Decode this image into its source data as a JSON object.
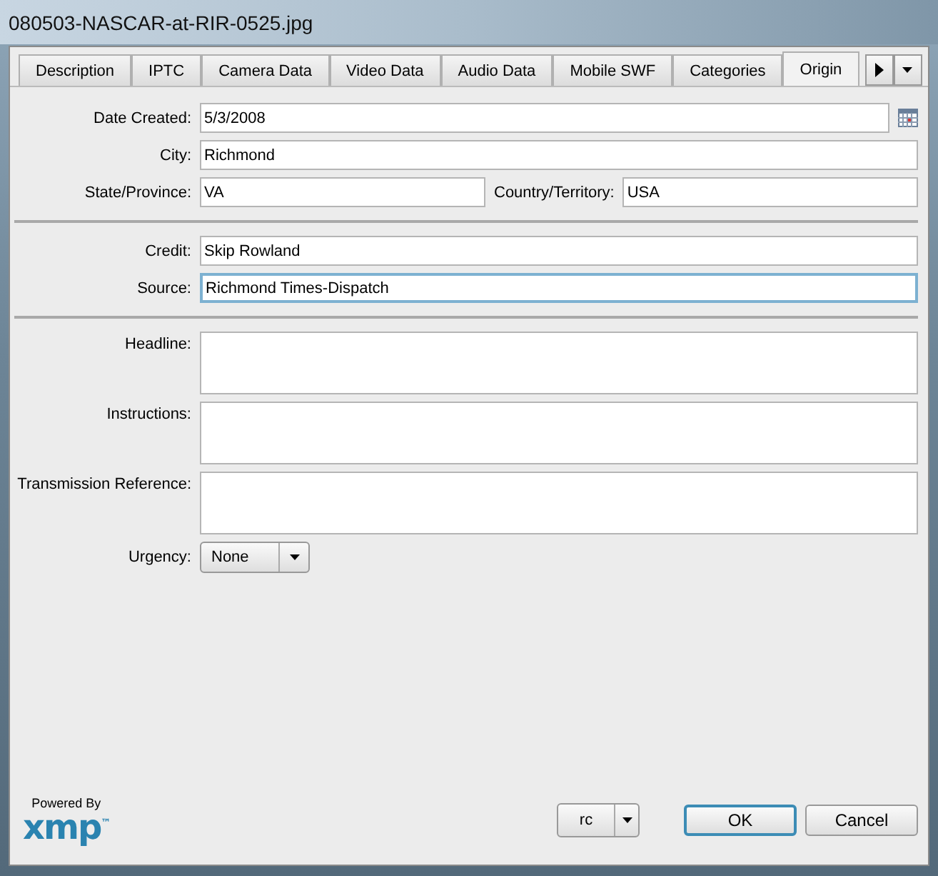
{
  "window": {
    "title": "080503-NASCAR-at-RIR-0525.jpg"
  },
  "tabs": [
    {
      "label": "Description",
      "selected": false
    },
    {
      "label": "IPTC",
      "selected": false
    },
    {
      "label": "Camera Data",
      "selected": false
    },
    {
      "label": "Video Data",
      "selected": false
    },
    {
      "label": "Audio Data",
      "selected": false
    },
    {
      "label": "Mobile SWF",
      "selected": false
    },
    {
      "label": "Categories",
      "selected": false
    },
    {
      "label": "Origin",
      "selected": true
    }
  ],
  "sections": [
    [
      {
        "kind": "date",
        "label": "Date Created:",
        "value": "5/3/2008",
        "focused": false
      },
      {
        "kind": "text",
        "label": "City:",
        "value": "Richmond",
        "focused": false
      },
      {
        "kind": "pair",
        "label": "State/Province:",
        "value": "VA",
        "label2": "Country/Territory:",
        "value2": "USA",
        "focused": false
      }
    ],
    [
      {
        "kind": "text",
        "label": "Credit:",
        "value": "Skip Rowland",
        "focused": false
      },
      {
        "kind": "text",
        "label": "Source:",
        "value": "Richmond Times-Dispatch",
        "focused": true
      }
    ],
    [
      {
        "kind": "area",
        "label": "Headline:",
        "focused": false
      },
      {
        "kind": "area",
        "label": "Instructions:",
        "focused": false
      },
      {
        "kind": "area",
        "label": "Transmission Reference:",
        "focused": false
      },
      {
        "kind": "dropdown",
        "label": "Urgency:",
        "value": "None"
      }
    ]
  ],
  "footer": {
    "logo_caption": "Powered By",
    "logo": "xmp",
    "logo_mark": "™",
    "template_button": "rc",
    "buttons": [
      {
        "label": "OK",
        "default": true
      },
      {
        "label": "Cancel",
        "default": false
      }
    ]
  }
}
